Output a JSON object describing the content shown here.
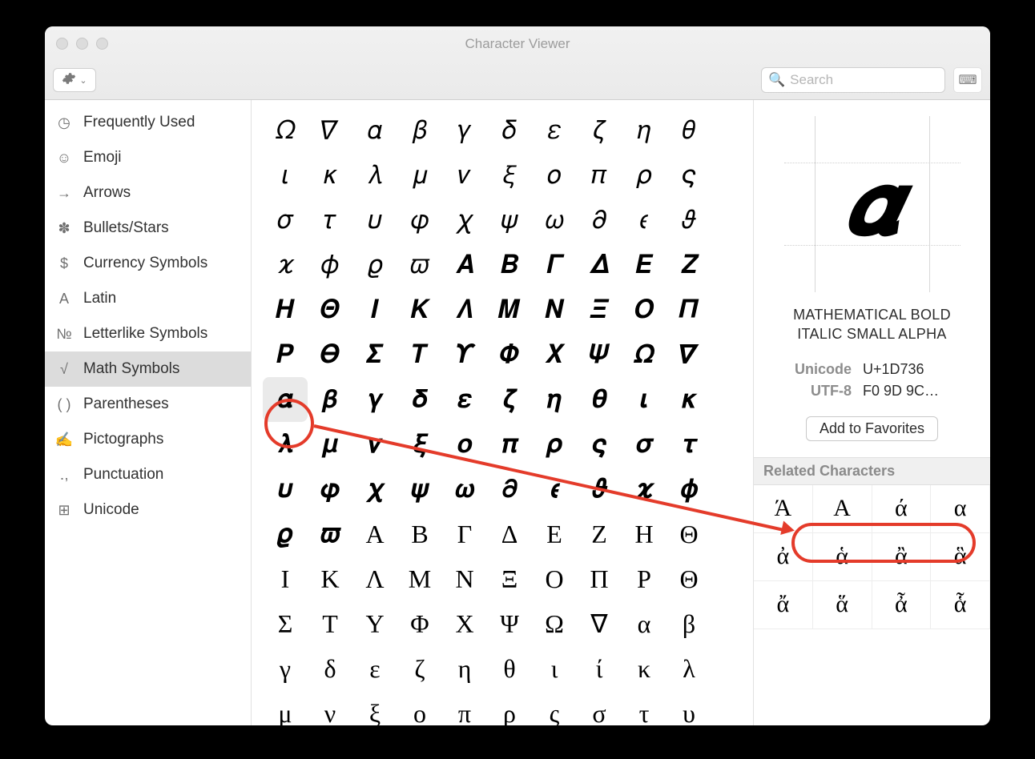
{
  "window": {
    "title": "Character Viewer"
  },
  "toolbar": {
    "search_placeholder": "Search"
  },
  "sidebar": {
    "items": [
      {
        "icon": "clock-icon",
        "glyph": "◷",
        "label": "Frequently Used"
      },
      {
        "icon": "emoji-icon",
        "glyph": "☺",
        "label": "Emoji"
      },
      {
        "icon": "arrow-icon",
        "glyph": "→",
        "label": "Arrows"
      },
      {
        "icon": "bullet-icon",
        "glyph": "✽",
        "label": "Bullets/Stars"
      },
      {
        "icon": "currency-icon",
        "glyph": "$",
        "label": "Currency Symbols"
      },
      {
        "icon": "latin-icon",
        "glyph": "A",
        "label": "Latin"
      },
      {
        "icon": "letterlike-icon",
        "glyph": "№",
        "label": "Letterlike Symbols"
      },
      {
        "icon": "math-icon",
        "glyph": "√",
        "label": "Math Symbols"
      },
      {
        "icon": "paren-icon",
        "glyph": "( )",
        "label": "Parentheses"
      },
      {
        "icon": "pictograph-icon",
        "glyph": "✍",
        "label": "Pictographs"
      },
      {
        "icon": "punct-icon",
        "glyph": "․,",
        "label": "Punctuation"
      },
      {
        "icon": "unicode-icon",
        "glyph": "⊞",
        "label": "Unicode"
      }
    ],
    "selected_index": 7
  },
  "grid": {
    "selected_index": 60,
    "cells": [
      "𝛺",
      "𝛻",
      "𝛼",
      "𝛽",
      "𝛾",
      "𝛿",
      "𝜀",
      "𝜁",
      "𝜂",
      "𝜃",
      "𝜄",
      "𝜅",
      "𝜆",
      "𝜇",
      "𝜈",
      "𝜉",
      "𝜊",
      "𝜋",
      "𝜌",
      "𝜍",
      "𝜎",
      "𝜏",
      "𝜐",
      "𝜑",
      "𝜒",
      "𝜓",
      "𝜔",
      "𝜕",
      "𝜖",
      "𝜗",
      "𝜘",
      "𝜙",
      "𝜚",
      "𝜛",
      "𝜜",
      "𝜝",
      "𝜞",
      "𝜟",
      "𝜠",
      "𝜡",
      "𝜢",
      "𝜣",
      "𝜤",
      "𝜥",
      "𝜦",
      "𝜧",
      "𝜨",
      "𝜩",
      "𝜪",
      "𝜫",
      "𝜬",
      "𝜭",
      "𝜮",
      "𝜯",
      "𝜰",
      "𝜱",
      "𝜲",
      "𝜳",
      "𝜴",
      "𝜵",
      "𝜶",
      "𝜷",
      "𝜸",
      "𝜹",
      "𝜺",
      "𝜻",
      "𝜼",
      "𝜽",
      "𝜾",
      "𝜿",
      "𝝀",
      "𝝁",
      "𝝂",
      "𝝃",
      "𝝄",
      "𝝅",
      "𝝆",
      "𝝇",
      "𝝈",
      "𝝉",
      "𝝊",
      "𝝋",
      "𝝌",
      "𝝍",
      "𝝎",
      "𝝏",
      "𝝐",
      "𝝑",
      "𝝒",
      "𝝓",
      "𝝔",
      "𝝕",
      "Α",
      "Β",
      "Γ",
      "Δ",
      "Ε",
      "Ζ",
      "Η",
      "Θ",
      "Ι",
      "Κ",
      "Λ",
      "Μ",
      "Ν",
      "Ξ",
      "Ο",
      "Π",
      "Ρ",
      "Θ",
      "Σ",
      "Τ",
      "Υ",
      "Φ",
      "Χ",
      "Ψ",
      "Ω",
      "∇",
      "α",
      "β",
      "γ",
      "δ",
      "ε",
      "ζ",
      "η",
      "θ",
      "ι",
      "ί",
      "κ",
      "λ",
      "μ",
      "ν",
      "ξ",
      "ο",
      "π",
      "ρ",
      "ς",
      "σ",
      "τ",
      "υ"
    ]
  },
  "detail": {
    "big_char": "𝜶",
    "name": "MATHEMATICAL BOLD ITALIC SMALL ALPHA",
    "codes": [
      {
        "label": "Unicode",
        "value": "U+1D736"
      },
      {
        "label": "UTF-8",
        "value": "F0 9D 9C…"
      }
    ],
    "favorites_label": "Add to Favorites",
    "related_header": "Related Characters",
    "related": [
      "Ά",
      "Α",
      "ά",
      "α",
      "ἀ",
      "ἁ",
      "ἂ",
      "ἃ",
      "ἄ",
      "ἅ",
      "ἆ",
      "ἇ"
    ]
  }
}
